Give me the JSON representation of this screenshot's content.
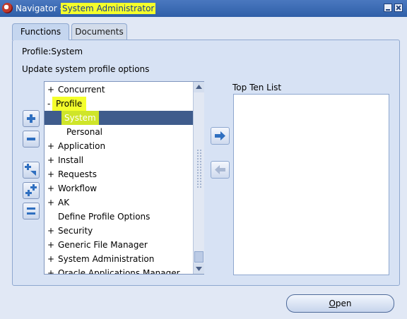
{
  "window": {
    "title_prefix": "Navigator - ",
    "title_role": "System Administrator"
  },
  "tabs": [
    {
      "label": "Functions",
      "active": true
    },
    {
      "label": "Documents",
      "active": false
    }
  ],
  "panel": {
    "profile_label": "Profile:System",
    "description": "Update system profile options"
  },
  "tree": {
    "items": [
      {
        "toggle": "+",
        "label": "Concurrent"
      },
      {
        "toggle": "-",
        "label": "Profile"
      },
      {
        "toggle": "",
        "label": "System"
      },
      {
        "toggle": "",
        "label": "Personal"
      },
      {
        "toggle": "+",
        "label": "Application"
      },
      {
        "toggle": "+",
        "label": "Install"
      },
      {
        "toggle": "+",
        "label": "Requests"
      },
      {
        "toggle": "+",
        "label": "Workflow"
      },
      {
        "toggle": "+",
        "label": "AK"
      },
      {
        "toggle": "",
        "label": "Define Profile Options"
      },
      {
        "toggle": "+",
        "label": "Security"
      },
      {
        "toggle": "+",
        "label": "Generic File Manager"
      },
      {
        "toggle": "+",
        "label": "System Administration"
      },
      {
        "toggle": "+",
        "label": "Oracle Applications Manager"
      }
    ]
  },
  "top_ten": {
    "label": "Top Ten List"
  },
  "buttons": {
    "open_mnemonic": "O",
    "open_rest": "pen"
  },
  "colors": {
    "highlight": "#f4ff2b",
    "selection": "#3f5c8c",
    "arrow_active": "#2f6fc0",
    "title_bar": "#3a68b2"
  }
}
